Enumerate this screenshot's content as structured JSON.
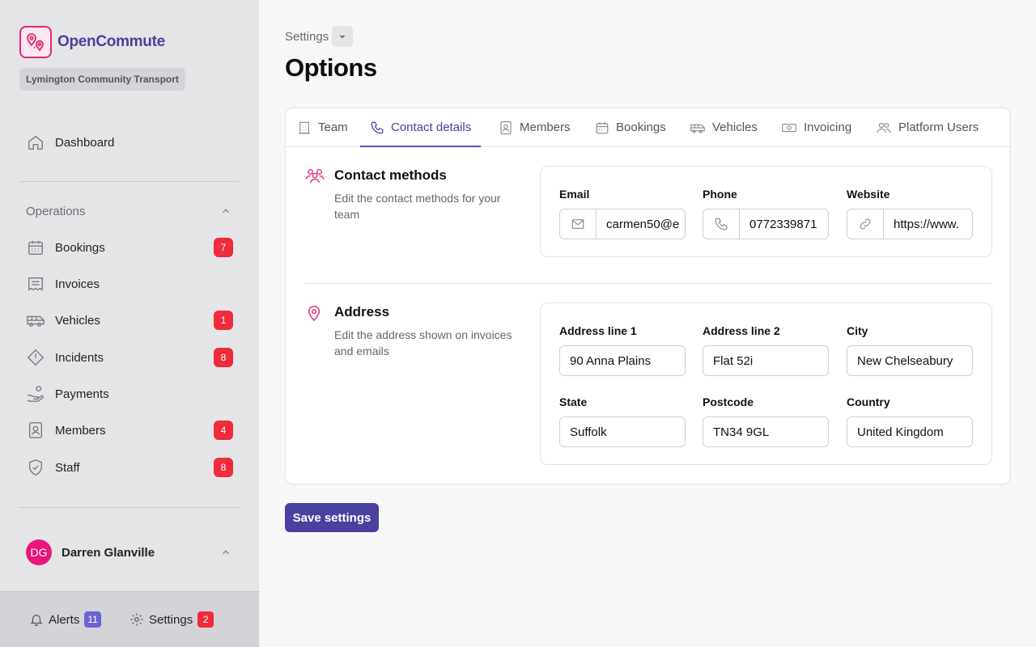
{
  "app": {
    "name": "OpenCommute",
    "organisation": "Lymington Community Transport"
  },
  "sidebar": {
    "dashboard": "Dashboard",
    "group_title": "Operations",
    "items": [
      {
        "label": "Bookings",
        "icon": "calendar-icon",
        "badge": "7"
      },
      {
        "label": "Invoices",
        "icon": "receipt-icon",
        "badge": null
      },
      {
        "label": "Vehicles",
        "icon": "bus-icon",
        "badge": "1"
      },
      {
        "label": "Incidents",
        "icon": "warning-diamond-icon",
        "badge": "8"
      },
      {
        "label": "Payments",
        "icon": "hand-coins-icon",
        "badge": null
      },
      {
        "label": "Members",
        "icon": "id-badge-icon",
        "badge": "4"
      },
      {
        "label": "Staff",
        "icon": "shield-check-icon",
        "badge": "8"
      }
    ],
    "user": {
      "initials": "DG",
      "name": "Darren Glanville"
    },
    "footer": {
      "alerts_label": "Alerts",
      "alerts_count": "11",
      "settings_label": "Settings",
      "settings_count": "2"
    }
  },
  "header": {
    "breadcrumb": "Settings",
    "title": "Options"
  },
  "tabs": [
    {
      "label": "Team",
      "icon": "building-icon",
      "active": false
    },
    {
      "label": "Contact details",
      "icon": "phone-icon",
      "active": true
    },
    {
      "label": "Members",
      "icon": "id-badge-icon",
      "active": false
    },
    {
      "label": "Bookings",
      "icon": "calendar-icon",
      "active": false
    },
    {
      "label": "Vehicles",
      "icon": "bus-icon",
      "active": false
    },
    {
      "label": "Invoicing",
      "icon": "money-icon",
      "active": false
    },
    {
      "label": "Platform Users",
      "icon": "users-icon",
      "active": false
    }
  ],
  "contact": {
    "title": "Contact methods",
    "description": "Edit the contact methods for your team",
    "email": {
      "label": "Email",
      "value": "carmen50@e"
    },
    "phone": {
      "label": "Phone",
      "value": "0772339871"
    },
    "website": {
      "label": "Website",
      "value": "https://www."
    }
  },
  "address": {
    "title": "Address",
    "description": "Edit the address shown on invoices and emails",
    "line1": {
      "label": "Address line 1",
      "value": "90 Anna Plains"
    },
    "line2": {
      "label": "Address line 2",
      "value": "Flat 52i"
    },
    "city": {
      "label": "City",
      "value": "New Chelseabury"
    },
    "state": {
      "label": "State",
      "value": "Suffolk"
    },
    "postcode": {
      "label": "Postcode",
      "value": "TN34 9GL"
    },
    "country": {
      "label": "Country",
      "value": "United Kingdom"
    }
  },
  "actions": {
    "save": "Save settings"
  },
  "colors": {
    "accent": "#4a40a0",
    "brand_pink": "#e0287a",
    "badge_red": "#ef2b3c"
  }
}
